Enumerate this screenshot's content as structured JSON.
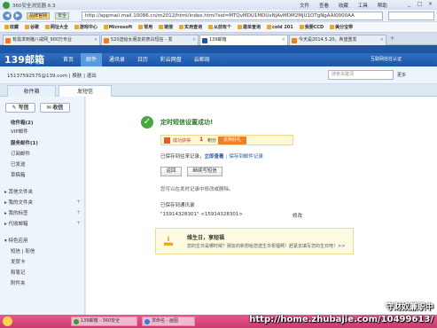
{
  "window": {
    "title": "360安全浏览器 6.3",
    "menus": [
      "文件",
      "查看",
      "收藏",
      "工具",
      "帮助"
    ],
    "controls": [
      "_",
      "□",
      "✕"
    ]
  },
  "address_bar": {
    "tag": "品牌官网",
    "tag2": "安全",
    "url": "http://appmail.mail.10086.cn/m2012/html/index.html?sid=MTQvMDU1MDUxNjAvMDM2MjU1OTgNgAAI0000AA"
  },
  "bookmarks": [
    "收藏",
    "谷歌",
    "网址大全",
    "游戏中心",
    "Microsoft",
    "常用",
    "链接",
    "实用查询",
    "从前有个",
    "建单查询",
    "cold 201",
    "我要CCD",
    "美分宝带"
  ],
  "tabs": [
    {
      "label": "有需求到猪八戒网_900万专业",
      "active": false
    },
    {
      "label": "520送给女朋友的表白短信 - 发",
      "active": false
    },
    {
      "label": "139邮箱",
      "active": true
    },
    {
      "label": "今天是2014.5.20，希望重发",
      "active": false
    }
  ],
  "mail_header": {
    "brand": "139邮箱",
    "nav": [
      "首页",
      "邮件",
      "通讯录",
      "日历",
      "彩云网盘",
      "云邮局"
    ],
    "active_nav": "邮件",
    "right": "互联网信任认证"
  },
  "userbar": {
    "address": "15137592575@139.com",
    "links": [
      "换肤",
      "退出"
    ],
    "search_placeholder": "搜索关键词",
    "more": "更多"
  },
  "mail_tabs": {
    "inbox": "收件箱",
    "sent": "发短信"
  },
  "sidebar": {
    "write": "写信",
    "receive": "收信",
    "items": [
      {
        "label": "收件箱(2)",
        "bold": true
      },
      {
        "label": "VIP邮件",
        "bold": false
      },
      {
        "label": "服务邮件(1)",
        "bold": true
      },
      {
        "label": "订阅邮件",
        "bold": false
      },
      {
        "label": "已发送",
        "bold": false
      },
      {
        "label": "草稿箱",
        "bold": false
      }
    ],
    "sections": [
      {
        "label": "其他文件夹"
      },
      {
        "label": "我的文件夹"
      },
      {
        "label": "我的标签"
      },
      {
        "label": "代收邮箱"
      }
    ],
    "apps_title": "特色应用",
    "apps": [
      "短信 | 彩信",
      "发贺卡",
      "和笔记",
      "附件夹"
    ]
  },
  "content": {
    "success": "定时短信设置成功!",
    "points_label": "成功获得",
    "points_value": "1",
    "points_unit": "积分",
    "points_btn": "去换好礼",
    "saved_prefix": "已保存到往来记录",
    "view_now": "立即查看",
    "sep": "|",
    "saved_link2": "保存到邮件记录",
    "btn_back": "返回",
    "btn_continue": "继续写短信",
    "hint": "您可以在发时记录中修改或删除。",
    "saved_to": "已保存到通讯录",
    "contact": "\"15914328301\" <15914328301>",
    "edit": "修改",
    "promo_title": "维生日，享短福",
    "promo_text": "您的生日是哪时候？朋友的新想给您送生日祝福啊！赶紧去填写您的生日吧！",
    "promo_link": ">>"
  },
  "taskbar": {
    "tasks": [
      "139邮箱 - 360安全",
      "求命名 - 画图"
    ]
  },
  "watermark": {
    "line1": "守财奴兼职中",
    "line2": "http://home.zhubajie.com/10499613/"
  }
}
